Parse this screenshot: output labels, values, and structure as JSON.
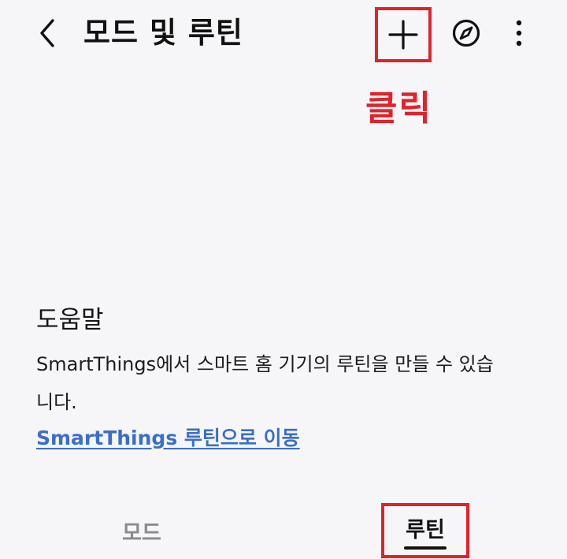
{
  "header": {
    "title": "모드 및 루틴",
    "back_icon": "chevron-left-icon",
    "add_icon": "plus-icon",
    "discover_icon": "compass-icon",
    "more_icon": "more-vertical-icon"
  },
  "annotation": {
    "label": "클릭",
    "color": "#e0232b"
  },
  "help": {
    "title": "도움말",
    "description": "SmartThings에서 스마트 홈 기기의 루틴을 만들 수 있습니다.",
    "link_label": "SmartThings 루틴으로 이동",
    "link_color": "#3a6ec9"
  },
  "tabs": [
    {
      "label": "모드",
      "selected": false
    },
    {
      "label": "루틴",
      "selected": true
    }
  ],
  "colors": {
    "background": "#f6f5f8",
    "highlight": "#e0232b"
  }
}
